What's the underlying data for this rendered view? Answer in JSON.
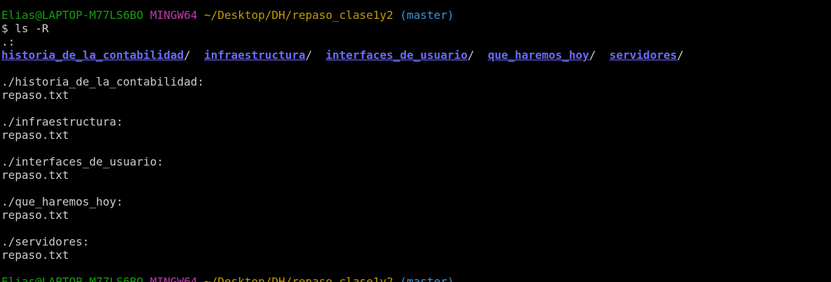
{
  "prompt": {
    "user_host": "Elias@LAPTOP-M77LS6BO",
    "system": "MINGW64",
    "path": "~/Desktop/DH/repaso_clase1y2",
    "branch": "(master)",
    "colors": {
      "user_host": "#13a10e",
      "system": "#c239b3",
      "path": "#c19c00",
      "branch": "#3a96dd"
    }
  },
  "command": "$ ls -R",
  "root_header": ".:",
  "root_entries": [
    "historia_de_la_contabilidad",
    "infraestructura",
    "interfaces_de_usuario",
    "que_haremos_hoy",
    "servidores"
  ],
  "dir_color": "#6b6bff",
  "sections": [
    {
      "header": "./historia_de_la_contabilidad:",
      "file": "repaso.txt"
    },
    {
      "header": "./infraestructura:",
      "file": "repaso.txt"
    },
    {
      "header": "./interfaces_de_usuario:",
      "file": "repaso.txt"
    },
    {
      "header": "./que_haremos_hoy:",
      "file": "repaso.txt"
    },
    {
      "header": "./servidores:",
      "file": "repaso.txt"
    }
  ],
  "next_prompt": {
    "user_host": "Elias@LAPTOP-M77LS6BO",
    "system": "MINGW64",
    "path": "~/Desktop/DH/repaso_clase1y2",
    "branch": "(master)"
  }
}
